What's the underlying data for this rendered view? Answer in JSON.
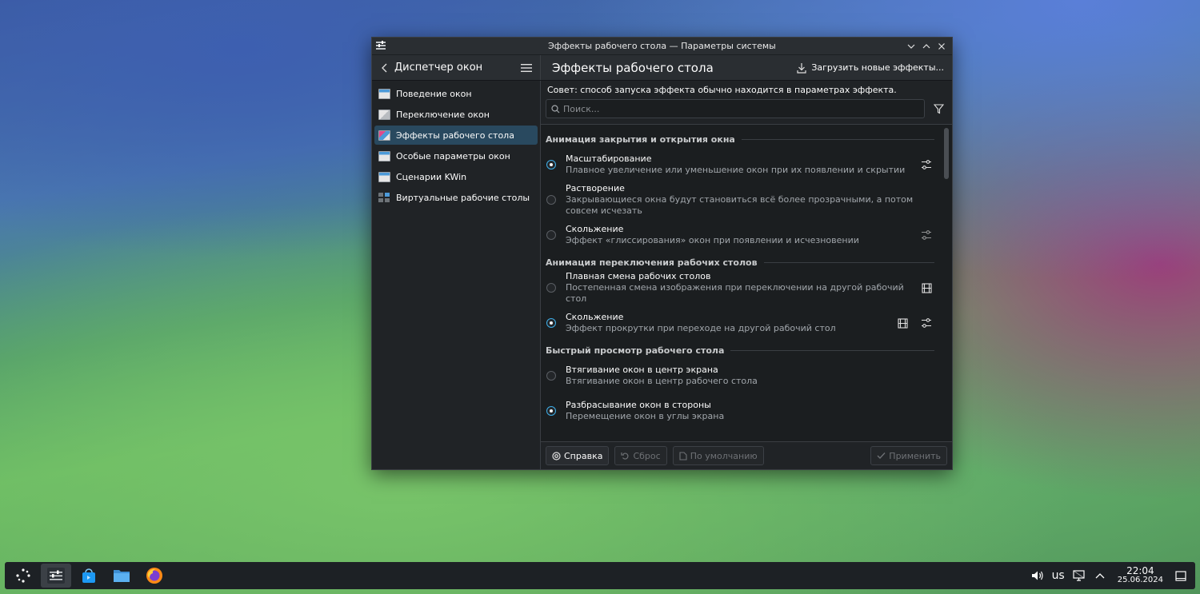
{
  "window": {
    "title": "Эффекты рабочего стола — Параметры системы",
    "back_label": "Диспетчер окон",
    "page_title": "Эффекты рабочего стола",
    "get_new_label": "Загрузить новые эффекты..."
  },
  "sidebar": {
    "items": [
      {
        "label": "Поведение окон",
        "icon": "window-behavior-icon",
        "active": false
      },
      {
        "label": "Переключение окон",
        "icon": "task-switcher-icon",
        "active": false
      },
      {
        "label": "Эффекты рабочего стола",
        "icon": "desktop-effects-icon",
        "active": true
      },
      {
        "label": "Особые параметры окон",
        "icon": "window-rules-icon",
        "active": false
      },
      {
        "label": "Сценарии KWin",
        "icon": "kwin-scripts-icon",
        "active": false
      },
      {
        "label": "Виртуальные рабочие столы",
        "icon": "virtual-desktops-icon",
        "active": false
      }
    ]
  },
  "main": {
    "hint": "Совет: способ запуска эффекта обычно находится в параметрах эффекта.",
    "search_placeholder": "Поиск...",
    "sections": [
      {
        "title": "Анимация закрытия и открытия окна",
        "effects": [
          {
            "name": "Масштабирование",
            "desc": "Плавное увеличение или уменьшение окон при их появлении и скрытии",
            "selected": true
          },
          {
            "name": "Растворение",
            "desc": "Закрывающиеся окна будут становиться всё более прозрачными, а потом совсем исчезать",
            "selected": false
          },
          {
            "name": "Скольжение",
            "desc": "Эффект «глиссирования» окон при появлении и исчезновении",
            "selected": false
          }
        ]
      },
      {
        "title": "Анимация переключения рабочих столов",
        "effects": [
          {
            "name": "Плавная смена рабочих столов",
            "desc": "Постепенная смена изображения при переключении на другой рабочий стол",
            "selected": false
          },
          {
            "name": "Скольжение",
            "desc": "Эффект прокрутки при переходе на другой рабочий стол",
            "selected": true
          }
        ]
      },
      {
        "title": "Быстрый просмотр рабочего стола",
        "effects": [
          {
            "name": "Втягивание окон в центр экрана",
            "desc": "Втягивание окон в центр рабочего стола",
            "selected": false
          },
          {
            "name": "Разбрасывание окон в стороны",
            "desc": "Перемещение окон в углы экрана",
            "selected": true
          }
        ]
      }
    ]
  },
  "footer": {
    "help_label": "Справка",
    "reset_label": "Сброс",
    "defaults_label": "По умолчанию",
    "apply_label": "Применить"
  },
  "taskbar": {
    "keyboard_layout": "us",
    "time": "22:04",
    "date": "25.06.2024"
  },
  "colors": {
    "accent": "#3daee9",
    "selection": "#29495f",
    "window_bg": "#202326"
  }
}
